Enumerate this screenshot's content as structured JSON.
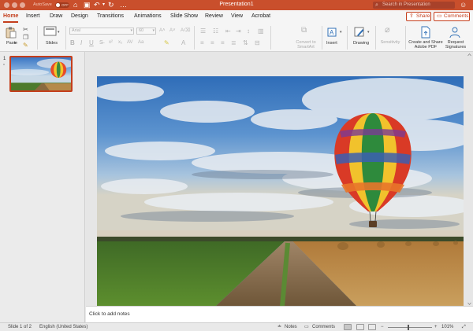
{
  "window": {
    "title": "Presentation1",
    "autosave_label": "AutoSave",
    "autosave_state": "OFF",
    "search_placeholder": "Search in Presentation"
  },
  "tabs": [
    {
      "label": "Home",
      "active": true
    },
    {
      "label": "Insert"
    },
    {
      "label": "Draw"
    },
    {
      "label": "Design"
    },
    {
      "label": "Transitions"
    },
    {
      "label": "Animations"
    },
    {
      "label": "Slide Show"
    },
    {
      "label": "Review"
    },
    {
      "label": "View"
    },
    {
      "label": "Acrobat"
    }
  ],
  "actions": {
    "share": "Share",
    "comments": "Comments"
  },
  "ribbon": {
    "paste": "Paste",
    "slides": "Slides",
    "font_name": "Arial",
    "font_size": "60",
    "convert_smartart": [
      "Convert to",
      "SmartArt"
    ],
    "insert": "Insert",
    "drawing": "Drawing",
    "sensitivity": "Sensitivity",
    "create_share_pdf": [
      "Create and Share",
      "Adobe PDF"
    ],
    "request_signatures": [
      "Request",
      "Signatures"
    ]
  },
  "thumbnails": [
    {
      "number": "1",
      "marker": "*"
    }
  ],
  "notes_placeholder": "Click to add notes",
  "status": {
    "slide_indicator": "Slide 1 of 2",
    "language": "English (United States)",
    "notes": "Notes",
    "comments": "Comments",
    "zoom": "101%"
  },
  "colors": {
    "title_bar": "#c94f2c",
    "accent": "#c43e1c",
    "app_background": "#e8e8e8"
  }
}
